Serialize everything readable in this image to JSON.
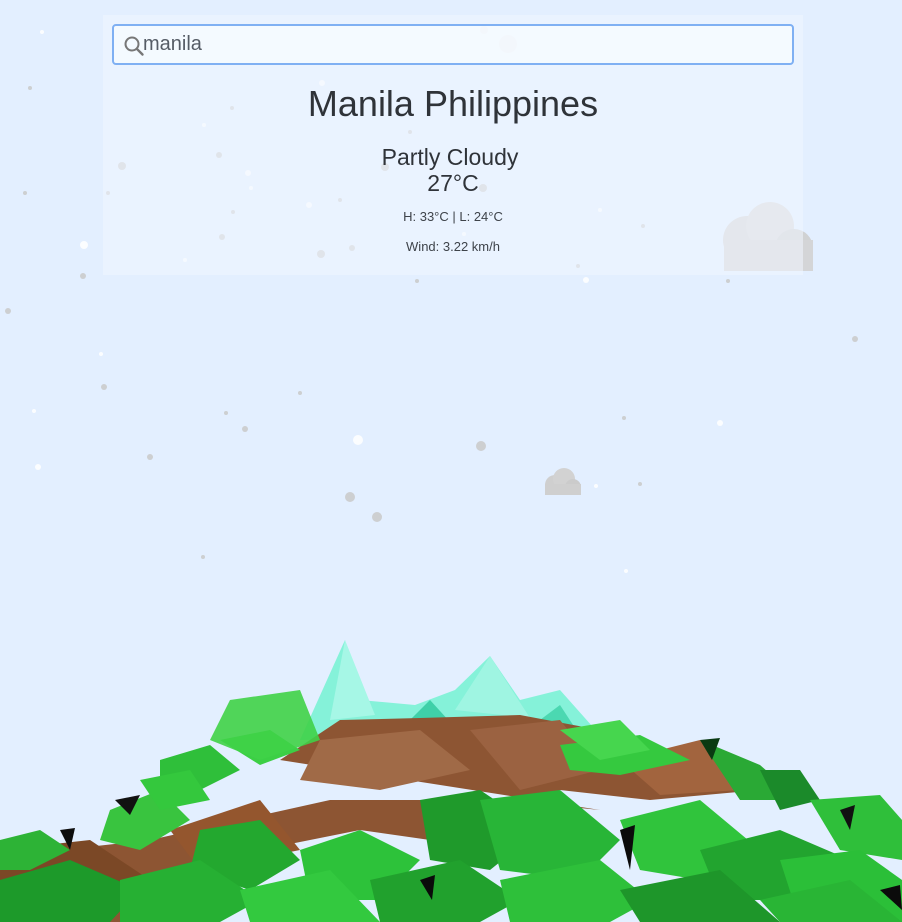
{
  "search": {
    "value": "manila",
    "icon": "search-icon"
  },
  "weather": {
    "city": "Manila Philippines",
    "condition": "Partly Cloudy",
    "temperature": "27°C",
    "high_low": "H: 33°C | L: 24°C",
    "wind": "Wind: 3.22 km/h"
  },
  "colors": {
    "sky": "#e3efff",
    "grass": "#2fbf3a",
    "dirt": "#8a5230",
    "peak": "#7ff0d6",
    "cloud": "#d4d4d4",
    "focus_border": "#7fb0f3"
  }
}
